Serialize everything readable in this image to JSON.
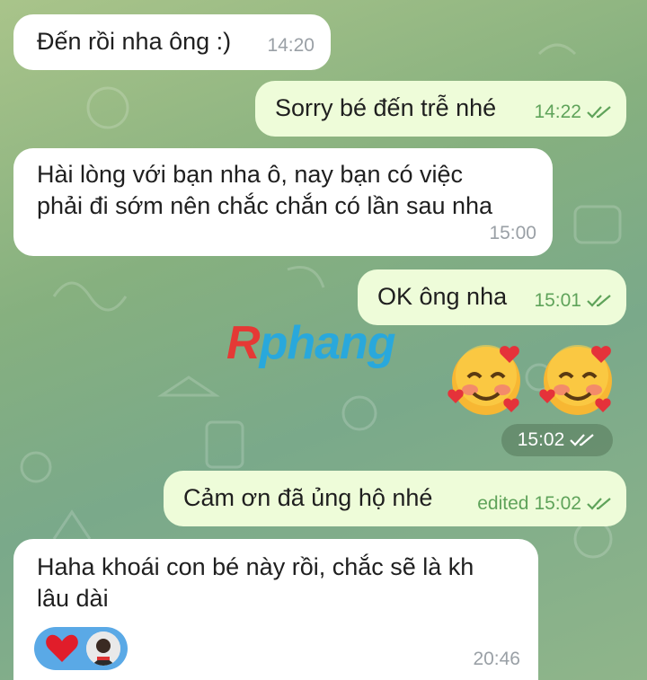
{
  "chat": {
    "messages": [
      {
        "direction": "in",
        "text": "Đến rồi nha ông :)",
        "time": "14:20"
      },
      {
        "direction": "out",
        "text": "Sorry bé đến trễ nhé",
        "time": "14:22"
      },
      {
        "direction": "in",
        "text_line1": "Hài lòng với bạn nha ô, nay bạn có việc",
        "text_line2": "phải đi sớm nên chắc chắn có lần sau nha",
        "time": "15:00"
      },
      {
        "direction": "out",
        "text": "OK ông nha",
        "time": "15:01"
      },
      {
        "direction": "out",
        "type": "emoji",
        "emoji": "🥰🥰",
        "time": "15:02"
      },
      {
        "direction": "out",
        "text": "Cảm ơn đã ủng hộ nhé",
        "edited_label": "edited",
        "time": "15:02"
      },
      {
        "direction": "in",
        "text_line1": "Haha khoái con bé này rồi, chắc sẽ là kh",
        "text_line2": "lâu dài",
        "time": "20:46",
        "reactions": [
          "heart",
          "avatar"
        ]
      }
    ]
  },
  "watermark": {
    "first_letter": "R",
    "rest": "phang"
  },
  "colors": {
    "incoming": "#ffffff",
    "outgoing": "#eefcd9",
    "tick": "#5fa35a",
    "reaction_bg": "#5aa9e6"
  }
}
